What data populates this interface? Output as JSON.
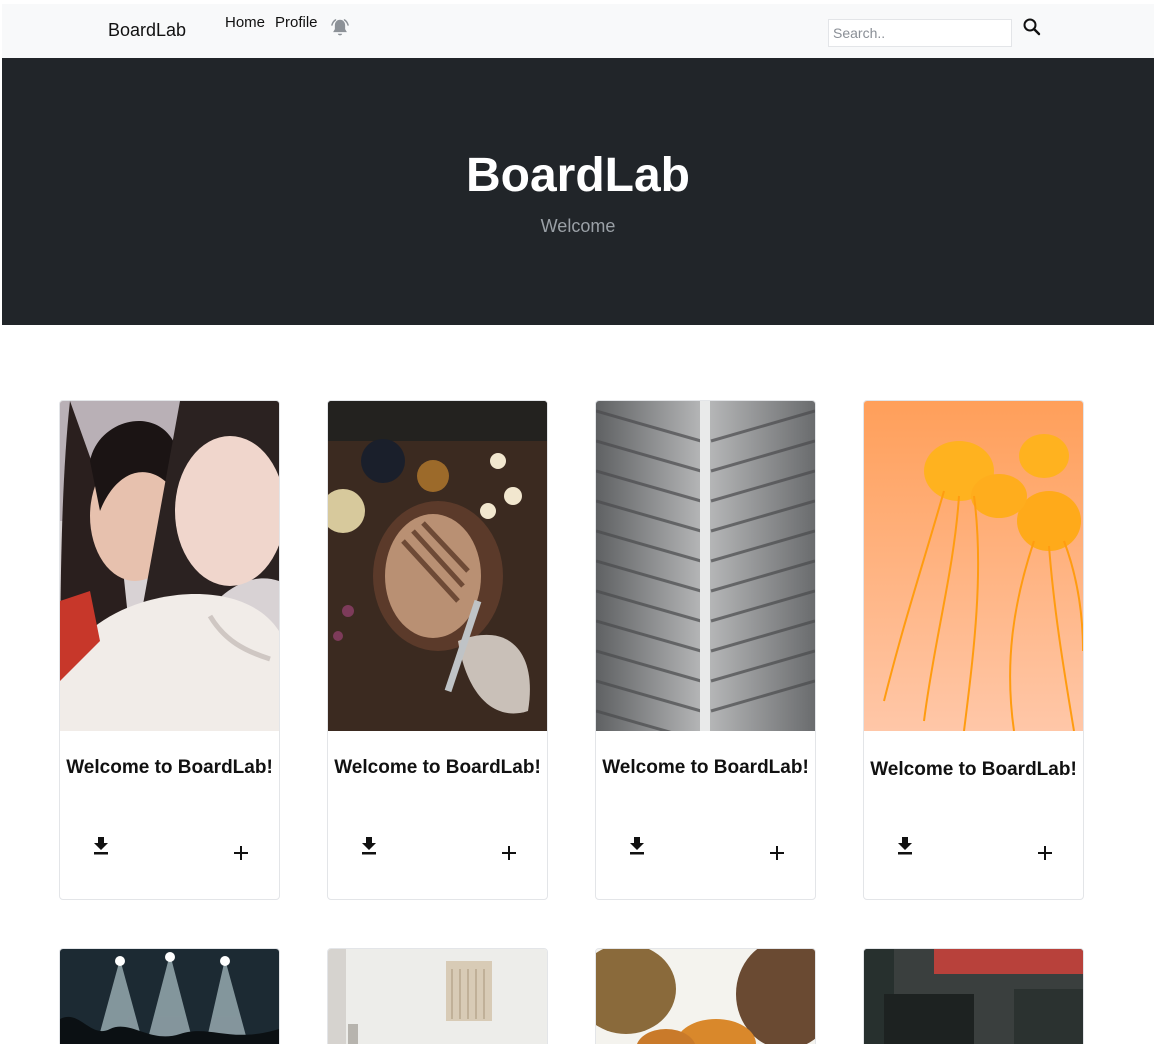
{
  "nav": {
    "brand": "BoardLab",
    "links": [
      "Home",
      "Profile"
    ],
    "search_placeholder": "Search.."
  },
  "hero": {
    "title": "BoardLab",
    "subtitle": "Welcome"
  },
  "cards": [
    {
      "title": "Welcome to BoardLab!"
    },
    {
      "title": "Welcome to BoardLab!"
    },
    {
      "title": "Welcome to BoardLab!"
    },
    {
      "title": "Welcome to BoardLab!"
    }
  ],
  "icons": {
    "notifications": "bell-icon",
    "search": "search-icon",
    "download": "download-icon",
    "add": "plus-icon"
  },
  "colors": {
    "navbar_bg": "#f8f9fa",
    "hero_bg": "#212529"
  }
}
